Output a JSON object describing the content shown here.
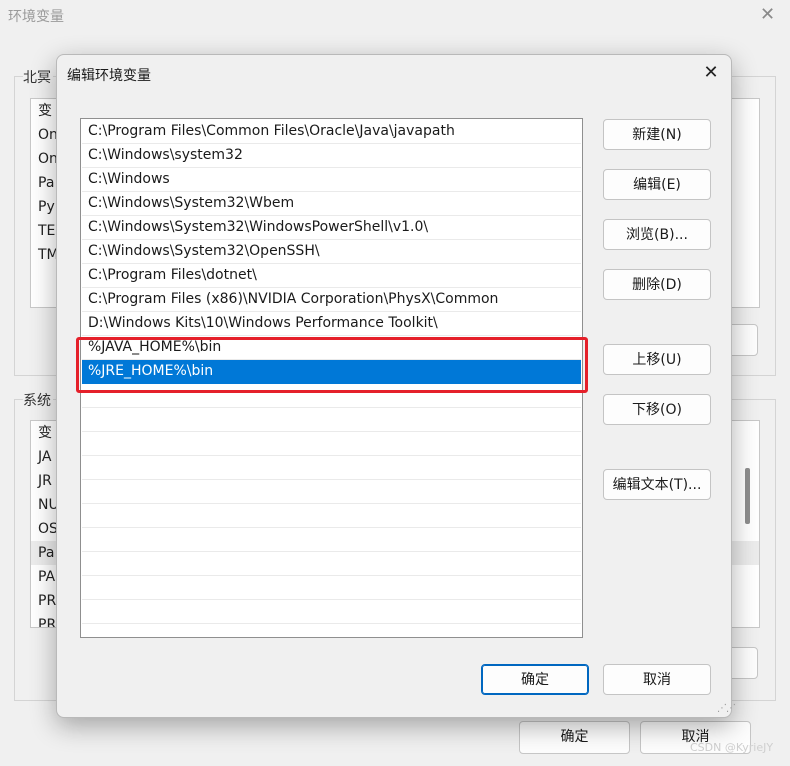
{
  "background_window": {
    "title": "环境变量",
    "user_group_label": "北冥",
    "system_group_label": "系统",
    "user_vars": [
      "变",
      "On",
      "On",
      "Pa",
      "Py",
      "TE",
      "TM"
    ],
    "system_vars": [
      "变",
      "JA",
      "JR",
      "NU",
      "OS",
      "Pa",
      "PA",
      "PR",
      "PR"
    ],
    "ok_label": "确定",
    "cancel_label": "取消"
  },
  "dialog": {
    "title": "编辑环境变量",
    "paths": [
      "C:\\Program Files\\Common Files\\Oracle\\Java\\javapath",
      "C:\\Windows\\system32",
      "C:\\Windows",
      "C:\\Windows\\System32\\Wbem",
      "C:\\Windows\\System32\\WindowsPowerShell\\v1.0\\",
      "C:\\Windows\\System32\\OpenSSH\\",
      "C:\\Program Files\\dotnet\\",
      "C:\\Program Files (x86)\\NVIDIA Corporation\\PhysX\\Common",
      "D:\\Windows Kits\\10\\Windows Performance Toolkit\\",
      "%JAVA_HOME%\\bin",
      "%JRE_HOME%\\bin"
    ],
    "buttons": {
      "new": "新建(N)",
      "edit": "编辑(E)",
      "browse": "浏览(B)...",
      "delete": "删除(D)",
      "move_up": "上移(U)",
      "move_down": "下移(O)",
      "edit_text": "编辑文本(T)...",
      "ok": "确定",
      "cancel": "取消"
    }
  },
  "watermark": "CSDN @KyrieJY",
  "colors": {
    "selection": "#0078d7",
    "highlight_box": "#e5202a",
    "primary_border": "#0067c0"
  },
  "icons": {
    "close": "close-icon",
    "resize": "resize-grip-icon"
  }
}
